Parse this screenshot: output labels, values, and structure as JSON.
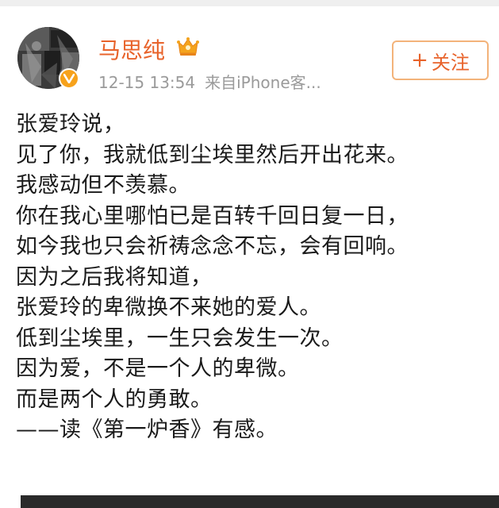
{
  "user": {
    "name": "马思纯",
    "timestamp": "12-15 13:54",
    "source": "来自iPhone客..."
  },
  "follow": {
    "label": "关注",
    "plus": "+"
  },
  "post": {
    "lines": [
      "张爱玲说，",
      "见了你，我就低到尘埃里然后开出花来。",
      "我感动但不羡慕。",
      "你在我心里哪怕已是百转千回日复一日，",
      "如今我也只会祈祷念念不忘，会有回响。",
      "因为之后我将知道，",
      "张爱玲的卑微换不来她的爱人。",
      "低到尘埃里，一生只会发生一次。",
      "因为爱，不是一个人的卑微。",
      "而是两个人的勇敢。",
      "——读《第一炉香》有感。"
    ]
  },
  "colors": {
    "username": "#e8632b",
    "follow_border": "#f3b37a",
    "meta": "#9a9a9a",
    "badge": "#f7a21b"
  },
  "icons": {
    "vip": "vip-crown-icon",
    "verified": "verified-v-icon"
  }
}
